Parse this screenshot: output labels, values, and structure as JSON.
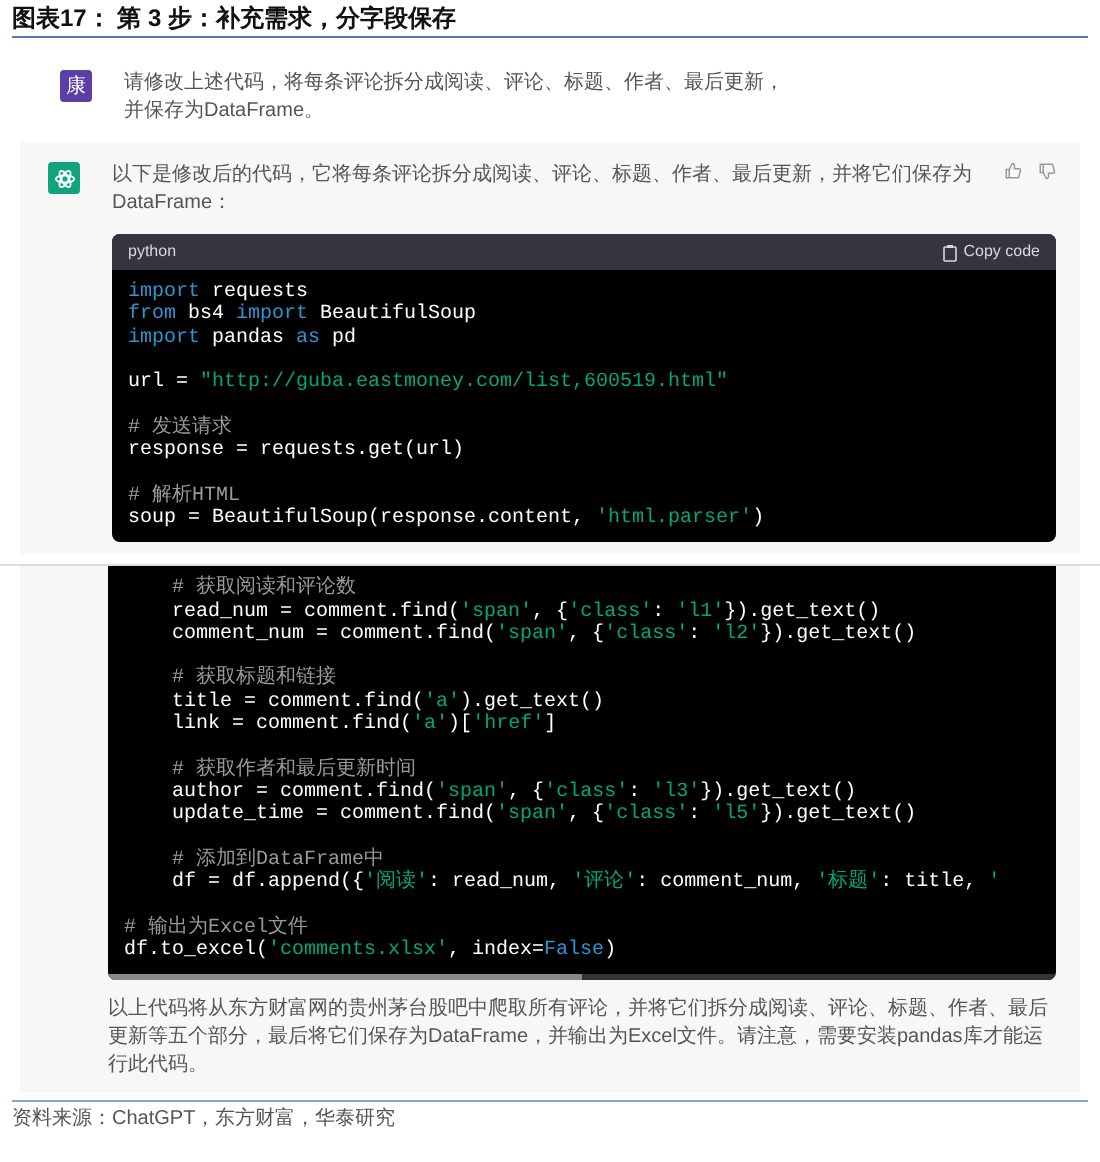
{
  "figure_title": "图表17：  第 3 步：补充需求，分字段保存",
  "user_message": {
    "avatar": "康",
    "text": "请修改上述代码，将每条评论拆分成阅读、评论、标题、作者、最后更新，并保存为DataFrame。"
  },
  "reply_top": {
    "text": "以下是修改后的代码，它将每条评论拆分成阅读、评论、标题、作者、最后更新，并将它们保存为DataFrame：",
    "code_header": {
      "language": "python",
      "copy_label": "Copy code"
    },
    "code_lines": [
      {
        "segments": [
          {
            "kind": "kw",
            "text": "import"
          },
          {
            "kind": "plain",
            "text": " requests"
          }
        ]
      },
      {
        "segments": [
          {
            "kind": "kw",
            "text": "from"
          },
          {
            "kind": "plain",
            "text": " bs4 "
          },
          {
            "kind": "kw",
            "text": "import"
          },
          {
            "kind": "plain",
            "text": " BeautifulSoup"
          }
        ]
      },
      {
        "segments": [
          {
            "kind": "kw",
            "text": "import"
          },
          {
            "kind": "plain",
            "text": " pandas "
          },
          {
            "kind": "kw",
            "text": "as"
          },
          {
            "kind": "plain",
            "text": " pd"
          }
        ]
      },
      {
        "blank_before": true,
        "segments": [
          {
            "kind": "plain",
            "text": "url = "
          },
          {
            "kind": "str",
            "text": "\"http://guba.eastmoney.com/list,600519.html\""
          }
        ]
      },
      {
        "blank_before": true,
        "segments": [
          {
            "kind": "comment",
            "text": "# 发送请求"
          }
        ]
      },
      {
        "segments": [
          {
            "kind": "plain",
            "text": "response = requests.get(url)"
          }
        ]
      },
      {
        "blank_before": true,
        "segments": [
          {
            "kind": "comment",
            "text": "# 解析HTML"
          }
        ]
      },
      {
        "segments": [
          {
            "kind": "plain",
            "text": "soup = BeautifulSoup(response.content, "
          },
          {
            "kind": "str",
            "text": "'html.parser'"
          },
          {
            "kind": "plain",
            "text": ")"
          }
        ]
      }
    ]
  },
  "reply_bottom": {
    "code_lines": [
      {
        "segments": [
          {
            "kind": "comment",
            "text": "    # 获取阅读和评论数"
          }
        ]
      },
      {
        "segments": [
          {
            "kind": "plain",
            "text": "    read_num = comment.find("
          },
          {
            "kind": "str",
            "text": "'span'"
          },
          {
            "kind": "plain",
            "text": ", {"
          },
          {
            "kind": "str",
            "text": "'class'"
          },
          {
            "kind": "plain",
            "text": ": "
          },
          {
            "kind": "str",
            "text": "'l1'"
          },
          {
            "kind": "plain",
            "text": "}).get_text()"
          }
        ]
      },
      {
        "segments": [
          {
            "kind": "plain",
            "text": "    comment_num = comment.find("
          },
          {
            "kind": "str",
            "text": "'span'"
          },
          {
            "kind": "plain",
            "text": ", {"
          },
          {
            "kind": "str",
            "text": "'class'"
          },
          {
            "kind": "plain",
            "text": ": "
          },
          {
            "kind": "str",
            "text": "'l2'"
          },
          {
            "kind": "plain",
            "text": "}).get_text()"
          }
        ]
      },
      {
        "blank_before": true,
        "segments": [
          {
            "kind": "comment",
            "text": "    # 获取标题和链接"
          }
        ]
      },
      {
        "segments": [
          {
            "kind": "plain",
            "text": "    title = comment.find("
          },
          {
            "kind": "str",
            "text": "'a'"
          },
          {
            "kind": "plain",
            "text": ").get_text()"
          }
        ]
      },
      {
        "segments": [
          {
            "kind": "plain",
            "text": "    link = comment.find("
          },
          {
            "kind": "str",
            "text": "'a'"
          },
          {
            "kind": "plain",
            "text": ")["
          },
          {
            "kind": "str",
            "text": "'href'"
          },
          {
            "kind": "plain",
            "text": "]"
          }
        ]
      },
      {
        "blank_before": true,
        "segments": [
          {
            "kind": "comment",
            "text": "    # 获取作者和最后更新时间"
          }
        ]
      },
      {
        "segments": [
          {
            "kind": "plain",
            "text": "    author = comment.find("
          },
          {
            "kind": "str",
            "text": "'span'"
          },
          {
            "kind": "plain",
            "text": ", {"
          },
          {
            "kind": "str",
            "text": "'class'"
          },
          {
            "kind": "plain",
            "text": ": "
          },
          {
            "kind": "str",
            "text": "'l3'"
          },
          {
            "kind": "plain",
            "text": "}).get_text()"
          }
        ]
      },
      {
        "segments": [
          {
            "kind": "plain",
            "text": "    update_time = comment.find("
          },
          {
            "kind": "str",
            "text": "'span'"
          },
          {
            "kind": "plain",
            "text": ", {"
          },
          {
            "kind": "str",
            "text": "'class'"
          },
          {
            "kind": "plain",
            "text": ": "
          },
          {
            "kind": "str",
            "text": "'l5'"
          },
          {
            "kind": "plain",
            "text": "}).get_text()"
          }
        ]
      },
      {
        "blank_before": true,
        "segments": [
          {
            "kind": "comment",
            "text": "    # 添加到DataFrame中"
          }
        ]
      },
      {
        "segments": [
          {
            "kind": "plain",
            "text": "    df = df.append({"
          },
          {
            "kind": "str",
            "text": "'阅读'"
          },
          {
            "kind": "plain",
            "text": ": read_num, "
          },
          {
            "kind": "str",
            "text": "'评论'"
          },
          {
            "kind": "plain",
            "text": ": comment_num, "
          },
          {
            "kind": "str",
            "text": "'标题'"
          },
          {
            "kind": "plain",
            "text": ": title, "
          },
          {
            "kind": "str",
            "text": "'"
          }
        ]
      },
      {
        "blank_before": true,
        "segments": [
          {
            "kind": "comment",
            "text": "# 输出为Excel文件"
          }
        ]
      },
      {
        "segments": [
          {
            "kind": "plain",
            "text": "df.to_excel("
          },
          {
            "kind": "str",
            "text": "'comments.xlsx'"
          },
          {
            "kind": "plain",
            "text": ", index="
          },
          {
            "kind": "kw",
            "text": "False"
          },
          {
            "kind": "plain",
            "text": ")"
          }
        ]
      }
    ],
    "text": "以上代码将从东方财富网的贵州茅台股吧中爬取所有评论，并将它们拆分成阅读、评论、标题、作者、最后更新等五个部分，最后将它们保存为DataFrame，并输出为Excel文件。请注意，需要安装pandas库才能运行此代码。"
  },
  "source": "资料来源：ChatGPT，东方财富，华泰研究"
}
